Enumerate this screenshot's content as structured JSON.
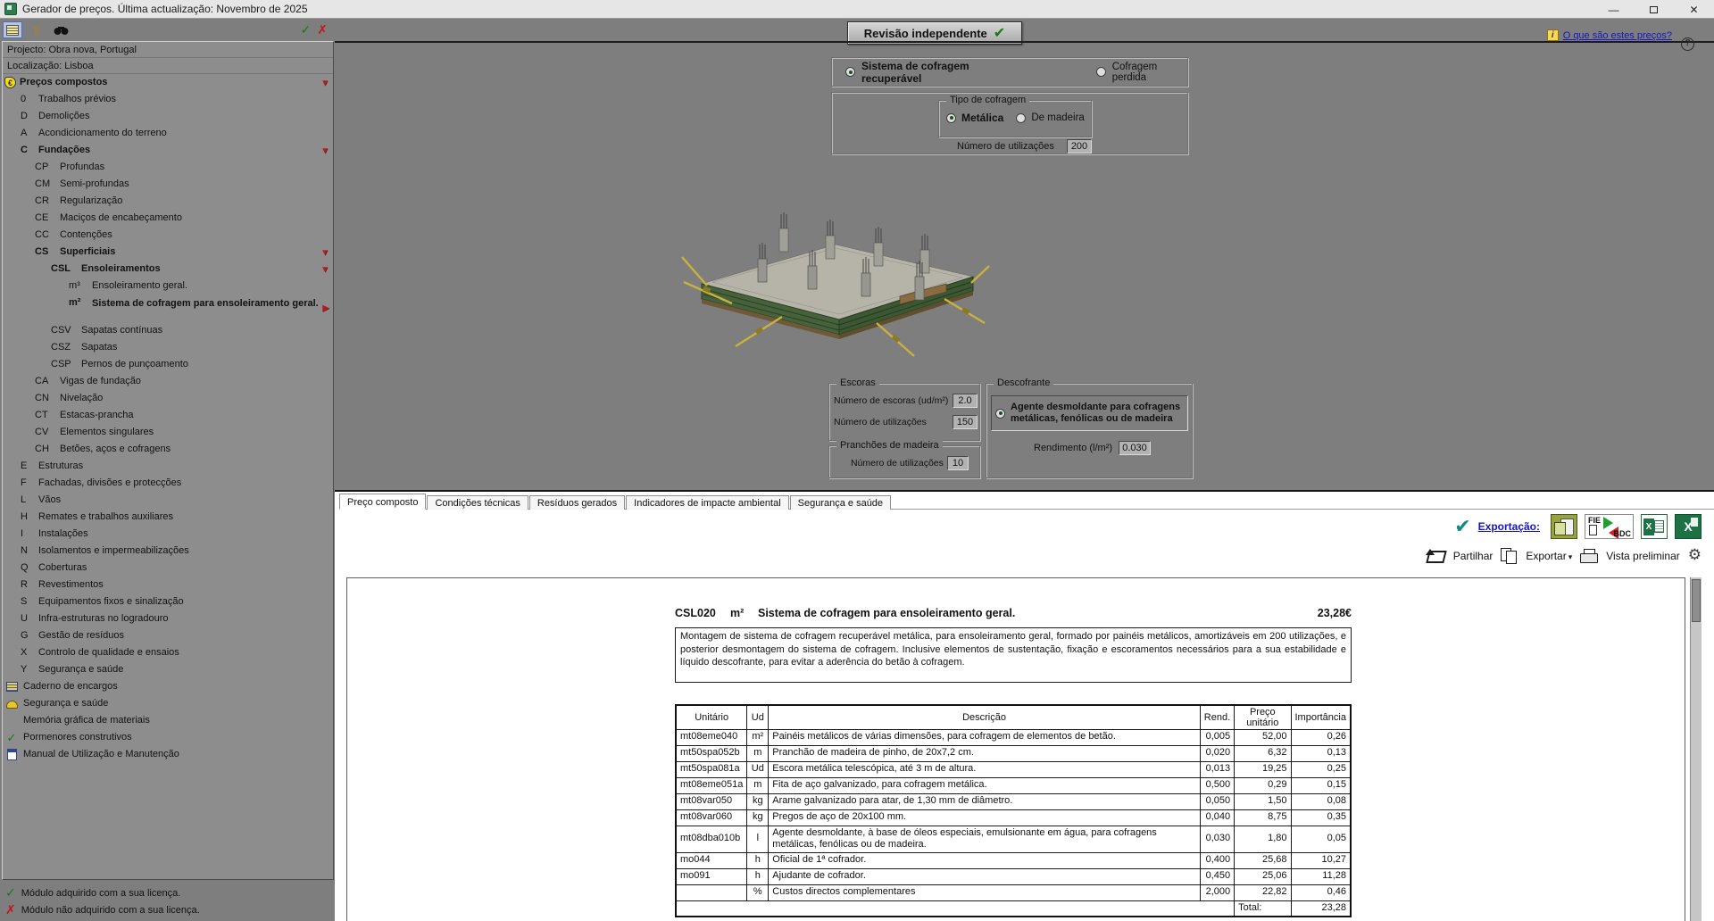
{
  "window": {
    "title": "Gerador de preços. Última actualização: Novembro de 2025"
  },
  "icons": {
    "check": "✓",
    "big_check": "✔",
    "cross": "✗",
    "arrow_down": "▼",
    "arrow_right": "▶",
    "up_arrow": "⇧",
    "gear": "⚙",
    "minimize": "—",
    "close": "✕",
    "question": "?",
    "info": "i",
    "euro": "€",
    "caret": "▾",
    "excel_x": "X"
  },
  "header": {
    "review_label": "Revisão independente",
    "help_link": "O que são estes preços?"
  },
  "sidebar": {
    "project": "Projecto: Obra nova, Portugal",
    "location": "Localização: Lisboa",
    "root_label": "Preços compostos",
    "items": [
      {
        "code": "0",
        "label": "Trabalhos prévios",
        "level": 1
      },
      {
        "code": "D",
        "label": "Demolições",
        "level": 1
      },
      {
        "code": "A",
        "label": "Acondicionamento do terreno",
        "level": 1
      },
      {
        "code": "C",
        "label": "Fundações",
        "level": 1,
        "bold": true,
        "arrow": "down"
      },
      {
        "code": "CP",
        "label": "Profundas",
        "level": 2
      },
      {
        "code": "CM",
        "label": "Semi-profundas",
        "level": 2
      },
      {
        "code": "CR",
        "label": "Regularização",
        "level": 2
      },
      {
        "code": "CE",
        "label": "Maciços de encabeçamento",
        "level": 2
      },
      {
        "code": "CC",
        "label": "Contenções",
        "level": 2
      },
      {
        "code": "CS",
        "label": "Superficiais",
        "level": 2,
        "bold": true,
        "arrow": "down"
      },
      {
        "code": "CSL",
        "label": "Ensoleiramentos",
        "level": 3,
        "bold": true,
        "arrow": "down"
      },
      {
        "code": "m³",
        "label": "Ensoleiramento geral.",
        "level": 4
      },
      {
        "code": "m²",
        "label": "Sistema de cofragem para ensoleiramento geral.",
        "level": 4,
        "bold": true,
        "selected": true,
        "arrow": "right"
      },
      {
        "code": "CSV",
        "label": "Sapatas contínuas",
        "level": 3
      },
      {
        "code": "CSZ",
        "label": "Sapatas",
        "level": 3
      },
      {
        "code": "CSP",
        "label": "Pernos de punçoamento",
        "level": 3
      },
      {
        "code": "CA",
        "label": "Vigas de fundação",
        "level": 2
      },
      {
        "code": "CN",
        "label": "Nivelação",
        "level": 2
      },
      {
        "code": "CT",
        "label": "Estacas-prancha",
        "level": 2
      },
      {
        "code": "CV",
        "label": "Elementos singulares",
        "level": 2
      },
      {
        "code": "CH",
        "label": "Betões, aços e cofragens",
        "level": 2
      },
      {
        "code": "E",
        "label": "Estruturas",
        "level": 1
      },
      {
        "code": "F",
        "label": "Fachadas, divisões e protecções",
        "level": 1
      },
      {
        "code": "L",
        "label": "Vãos",
        "level": 1
      },
      {
        "code": "H",
        "label": "Remates e trabalhos auxiliares",
        "level": 1
      },
      {
        "code": "I",
        "label": "Instalações",
        "level": 1
      },
      {
        "code": "N",
        "label": "Isolamentos e impermeabilizações",
        "level": 1
      },
      {
        "code": "Q",
        "label": "Coberturas",
        "level": 1
      },
      {
        "code": "R",
        "label": "Revestimentos",
        "level": 1
      },
      {
        "code": "S",
        "label": "Equipamentos fixos e sinalização",
        "level": 1
      },
      {
        "code": "U",
        "label": "Infra-estruturas no logradouro",
        "level": 1
      },
      {
        "code": "G",
        "label": "Gestão de resíduos",
        "level": 1
      },
      {
        "code": "X",
        "label": "Controlo de qualidade e ensaios",
        "level": 1
      },
      {
        "code": "Y",
        "label": "Segurança e saúde",
        "level": 1
      }
    ],
    "extras": [
      {
        "icon": "scroll",
        "label": "Caderno de encargos"
      },
      {
        "icon": "helmet",
        "label": "Segurança e saúde"
      },
      {
        "icon": "none",
        "label": "Memória gráfica de materiais"
      },
      {
        "icon": "check",
        "label": "Pormenores construtivos"
      },
      {
        "icon": "manual",
        "label": "Manual de Utilização e Manutenção"
      }
    ],
    "legend_ok": "Módulo adquirido com a sua licença.",
    "legend_no": "Módulo não adquirido com a sua licença."
  },
  "options": {
    "system_selected": "Sistema de cofragem recuperável",
    "system_other": "Cofragem perdida",
    "tipo_legend": "Tipo de cofragem",
    "tipo_selected": "Metálica",
    "tipo_other": "De madeira",
    "usos_label": "Número de utilizações",
    "usos_value": "200"
  },
  "groups": {
    "escoras": {
      "title": "Escoras",
      "fields": [
        {
          "label": "Número de escoras (ud/m²)",
          "value": "2.0"
        },
        {
          "label": "Número de utilizações",
          "value": "150"
        }
      ]
    },
    "pranchoes": {
      "title": "Pranchões de madeira",
      "field_label": "Número de utilizações",
      "field_value": "10"
    },
    "descofrante": {
      "title": "Descofrante",
      "radio_label": "Agente desmoldante para cofragens metálicas, fenólicas ou de madeira",
      "rend_label": "Rendimento (l/m²)",
      "rend_value": "0.030"
    }
  },
  "tabs": {
    "active": 0,
    "items": [
      "Preço composto",
      "Condições técnicas",
      "Resíduos gerados",
      "Indicadores de impacte ambiental",
      "Segurança e saúde"
    ]
  },
  "export": {
    "exportacao": "Exportação:",
    "fie": "FIE",
    "bdc": "BDC",
    "partilhar": "Partilhar",
    "exportar": "Exportar",
    "vista": "Vista preliminar"
  },
  "doc": {
    "code": "CSL020",
    "unit": "m²",
    "title": "Sistema de cofragem para ensoleiramento geral.",
    "price": "23,28€",
    "description": "Montagem de sistema de cofragem recuperável metálica, para ensoleiramento geral, formado por painéis metálicos, amortizáveis em 200 utilizações, e posterior desmontagem do sistema de cofragem. Inclusive elementos de sustentação, fixação e escoramentos necessários para a sua estabilidade e líquido descofrante, para evitar a aderência do betão à cofragem.",
    "table": {
      "headers": [
        "Unitário",
        "Ud",
        "Descrição",
        "Rend.",
        "Preço unitário",
        "Importância"
      ],
      "rows": [
        [
          "mt08eme040",
          "m²",
          "Painéis metálicos de várias dimensões, para cofragem de elementos de betão.",
          "0,005",
          "52,00",
          "0,26"
        ],
        [
          "mt50spa052b",
          "m",
          "Pranchão de madeira de pinho, de 20x7,2 cm.",
          "0,020",
          "6,32",
          "0,13"
        ],
        [
          "mt50spa081a",
          "Ud",
          "Escora metálica telescópica, até 3 m de altura.",
          "0,013",
          "19,25",
          "0,25"
        ],
        [
          "mt08eme051a",
          "m",
          "Fita de aço galvanizado, para cofragem metálica.",
          "0,500",
          "0,29",
          "0,15"
        ],
        [
          "mt08var050",
          "kg",
          "Arame galvanizado para atar, de 1,30 mm de diâmetro.",
          "0,050",
          "1,50",
          "0,08"
        ],
        [
          "mt08var060",
          "kg",
          "Pregos de aço de 20x100 mm.",
          "0,040",
          "8,75",
          "0,35"
        ],
        [
          "mt08dba010b",
          "l",
          "Agente desmoldante, à base de óleos especiais, emulsionante em água, para cofragens metálicas, fenólicas ou de madeira.",
          "0,030",
          "1,80",
          "0,05"
        ],
        [
          "mo044",
          "h",
          "Oficial de 1ª cofrador.",
          "0,400",
          "25,68",
          "10,27"
        ],
        [
          "mo091",
          "h",
          "Ajudante de cofrador.",
          "0,450",
          "25,06",
          "11,28"
        ],
        [
          "",
          "%",
          "Custos directos complementares",
          "2,000",
          "22,82",
          "0,46"
        ]
      ],
      "total_label": "Total:",
      "total_value": "23,28"
    }
  }
}
